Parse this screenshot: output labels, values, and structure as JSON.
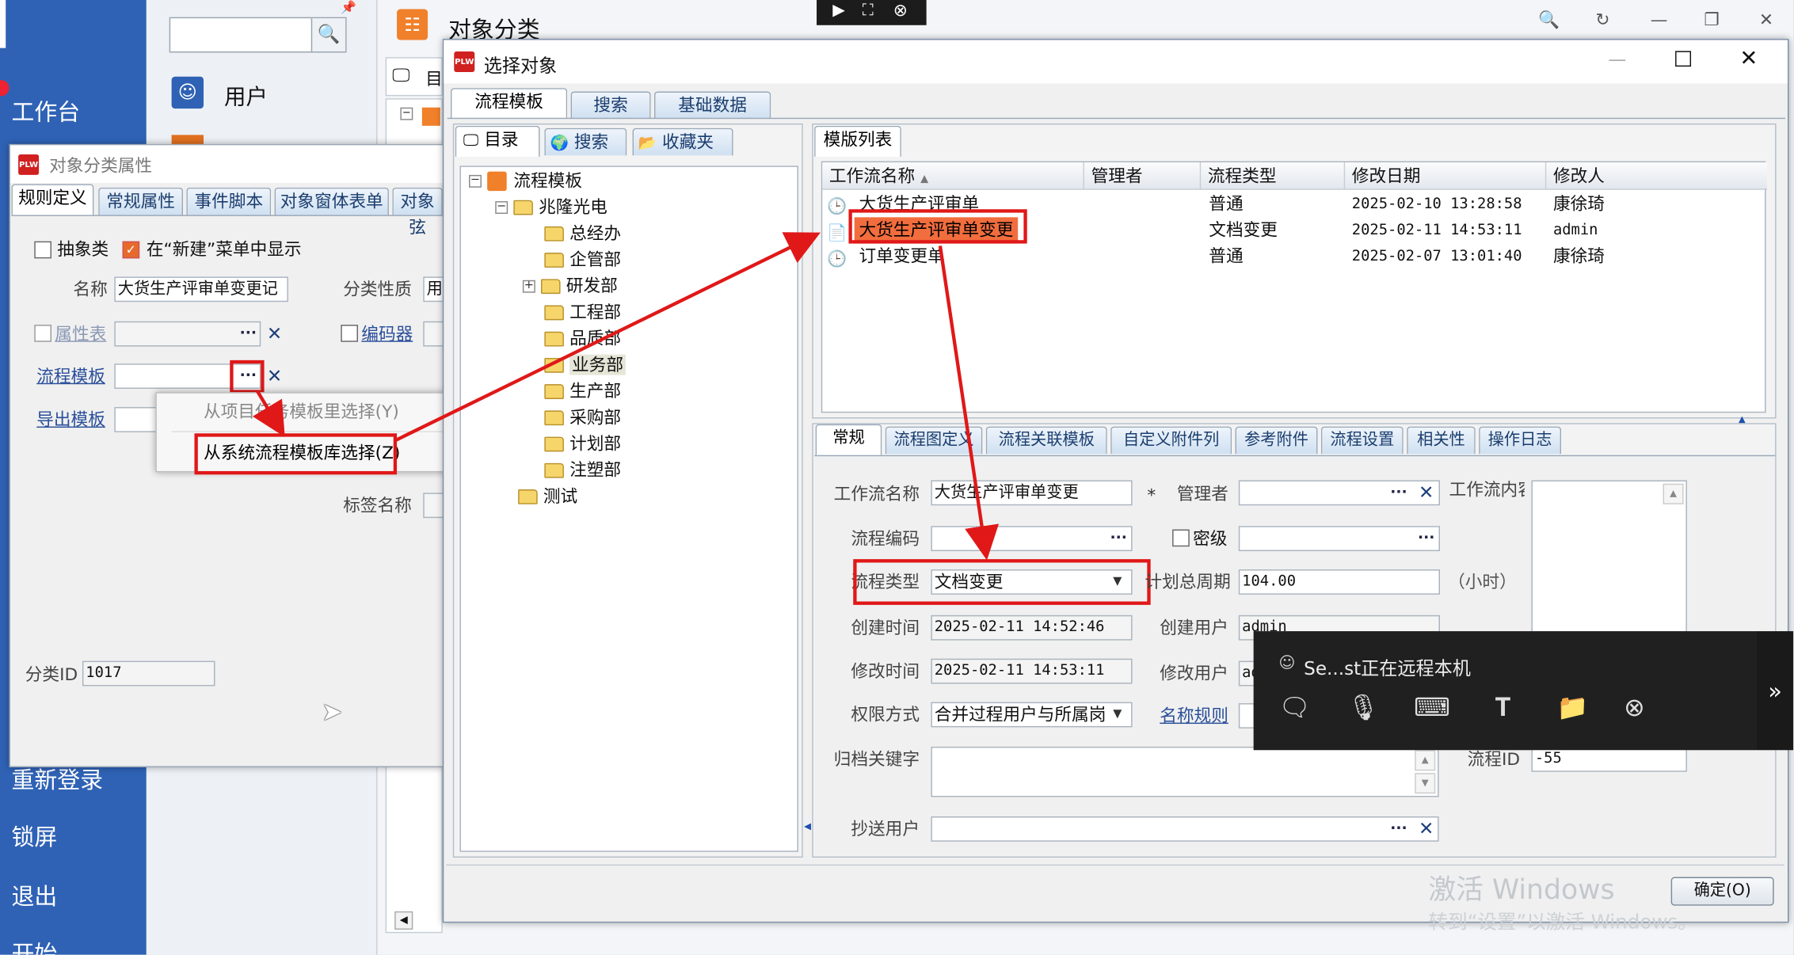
{
  "nav": {
    "workbench": "工作台",
    "relogin": "重新登录",
    "lock": "锁屏",
    "exit": "退出",
    "start": "开始"
  },
  "panel2": {
    "user_label": "用户"
  },
  "mainwin": {
    "title": "对象分类",
    "tree_tab": "目"
  },
  "remote_topbar": {},
  "props": {
    "title": "对象分类属性",
    "tabs": [
      "规则定义",
      "常规属性",
      "事件脚本",
      "对象窗体表单",
      "对象弦"
    ],
    "chk_abstract": "抽象类",
    "chk_show_new": "在“新建”菜单中显示",
    "name_label": "名称",
    "name_value": "大货生产评审单变更记",
    "category_label": "分类性质",
    "category_value": "用",
    "attr_table_label": "属性表",
    "encoder_label": "编码器",
    "flow_tpl_label": "流程模板",
    "export_tpl_label": "导出模板",
    "tag_label": "标签名称",
    "classid_label": "分类ID",
    "classid_value": "1017"
  },
  "context_menu": {
    "item1": "从项目任务模板里选择(Y)",
    "item2": "从系统流程模板库选择(Z)"
  },
  "dialog": {
    "title": "选择对象",
    "top_tabs": [
      "流程模板",
      "搜索",
      "基础数据"
    ],
    "sub_tabs": [
      "目录",
      "搜索",
      "收藏夹"
    ],
    "tree": {
      "root": "流程模板",
      "company": "兆隆光电",
      "depts": [
        "总经办",
        "企管部",
        "研发部",
        "工程部",
        "品质部",
        "业务部",
        "生产部",
        "采购部",
        "计划部",
        "注塑部"
      ],
      "test": "测试"
    },
    "list_tab": "模版列表",
    "columns": [
      "工作流名称",
      "管理者",
      "流程类型",
      "修改日期",
      "修改人"
    ],
    "rows": [
      {
        "name": "大货生产评审单",
        "manager": "",
        "type": "普通",
        "date": "2025-02-10 13:28:58",
        "by": "康徐琦"
      },
      {
        "name": "大货生产评审单变更",
        "manager": "",
        "type": "文档变更",
        "date": "2025-02-11 14:53:11",
        "by": "admin"
      },
      {
        "name": "订单变更单",
        "manager": "",
        "type": "普通",
        "date": "2025-02-07 13:01:40",
        "by": "康徐琦"
      }
    ],
    "detail_tabs": [
      "常规",
      "流程图定义",
      "流程关联模板",
      "自定义附件列",
      "参考附件",
      "流程设置",
      "相关性",
      "操作日志"
    ],
    "form": {
      "wf_name_label": "工作流名称",
      "wf_name_value": "大货生产评审单变更",
      "star": "*",
      "manager_label": "管理者",
      "content_label": "工作流内容",
      "code_label": "流程编码",
      "secret_label": "密级",
      "type_label": "流程类型",
      "type_value": "文档变更",
      "plan_label": "计划总周期",
      "plan_value": "104.00",
      "hours": "（小时）",
      "created_label": "创建时间",
      "created_value": "2025-02-11 14:52:46",
      "creator_label": "创建用户",
      "creator_value": "admin",
      "modified_label": "修改时间",
      "modified_value": "2025-02-11 14:53:11",
      "modifier_label": "修改用户",
      "modifier_value": "ad",
      "perm_label": "权限方式",
      "perm_value": "合并过程用户与所属岗",
      "naming_label": "名称规则",
      "archive_label": "归档关键字",
      "flowid_label": "流程ID",
      "flowid_value": "-55",
      "cc_label": "抄送用户"
    },
    "ok_button": "确定(O)",
    "watermark1": "激活 Windows",
    "watermark2": "转到“设置”以激活 Windows。"
  },
  "remote": {
    "status": "Se...st正在远程本机"
  }
}
